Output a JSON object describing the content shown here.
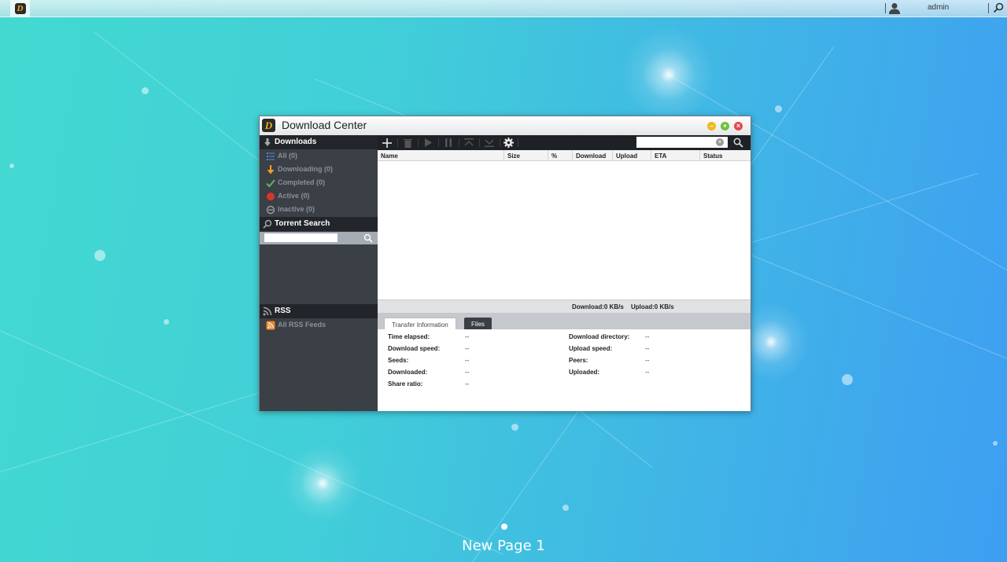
{
  "taskbar": {
    "user": "admin"
  },
  "window": {
    "title": "Download Center"
  },
  "sidebar": {
    "downloads_header": "Downloads",
    "items": [
      {
        "label": "All (0)",
        "icon": "list-icon"
      },
      {
        "label": "Downloading (0)",
        "icon": "down-arrow-icon"
      },
      {
        "label": "Completed (0)",
        "icon": "check-icon"
      },
      {
        "label": "Active (0)",
        "icon": "active-icon"
      },
      {
        "label": "Inactive (0)",
        "icon": "inactive-icon"
      }
    ],
    "torrent_search_header": "Torrent Search",
    "torrent_search_placeholder": "",
    "rss_header": "RSS",
    "rss_items": [
      {
        "label": "All RSS Feeds"
      }
    ]
  },
  "toolbar": {
    "search_placeholder": "",
    "tools": [
      "add-icon",
      "delete-icon",
      "resume-icon",
      "pause-icon",
      "move-top-icon",
      "move-bottom-icon",
      "settings-icon"
    ]
  },
  "columns": [
    "Name",
    "Size",
    "%",
    "Download",
    "Upload",
    "ETA",
    "Status"
  ],
  "status_bar": {
    "download": "Download:0 KB/s",
    "upload": "Upload:0 KB/s"
  },
  "detail_tabs": [
    "Transfer Information",
    "Files"
  ],
  "details": {
    "left": [
      {
        "label": "Time elapsed:",
        "value": "--"
      },
      {
        "label": "Download speed:",
        "value": "--"
      },
      {
        "label": "Seeds:",
        "value": "--"
      },
      {
        "label": "Downloaded:",
        "value": "--"
      },
      {
        "label": "Share ratio:",
        "value": "--"
      }
    ],
    "right": [
      {
        "label": "Download directory:",
        "value": "--"
      },
      {
        "label": "Upload speed:",
        "value": "--"
      },
      {
        "label": "Peers:",
        "value": "--"
      },
      {
        "label": "Uploaded:",
        "value": "--"
      }
    ]
  },
  "page_label": "New Page 1",
  "colors": {
    "accent": "#f0b020",
    "sidebar": "#3b3f46",
    "toolbar": "#1e2125"
  }
}
